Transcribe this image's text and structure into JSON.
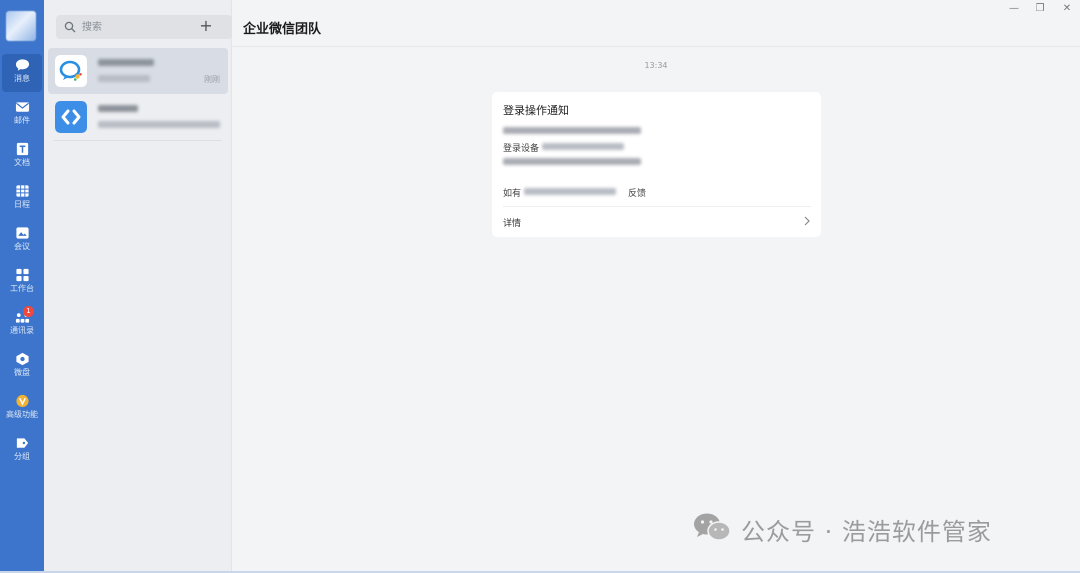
{
  "sidebar": {
    "items": [
      {
        "label": "消息",
        "icon": "chat-bubble-icon",
        "active": true
      },
      {
        "label": "邮件",
        "icon": "mail-icon"
      },
      {
        "label": "文档",
        "icon": "document-icon"
      },
      {
        "label": "日程",
        "icon": "calendar-icon"
      },
      {
        "label": "会议",
        "icon": "meeting-icon"
      },
      {
        "label": "工作台",
        "icon": "workbench-icon"
      },
      {
        "label": "通讯录",
        "icon": "contacts-icon",
        "badge": "1"
      },
      {
        "label": "微盘",
        "icon": "drive-icon"
      },
      {
        "label": "高级功能",
        "icon": "vip-icon"
      },
      {
        "label": "分组",
        "icon": "group-tag-icon"
      }
    ]
  },
  "search": {
    "placeholder": "搜索"
  },
  "conversations": [
    {
      "time": "刚刚",
      "active": true
    },
    {
      "time": ""
    }
  ],
  "chat": {
    "title": "企业微信团队",
    "timestamp": "13:34",
    "card": {
      "title": "登录操作通知",
      "line_device": "登录设备",
      "line_feedback_prefix": "如有",
      "line_feedback_suffix": "反馈",
      "detail_label": "详情"
    }
  },
  "window_controls": {
    "minimize": "—",
    "restore": "❐",
    "close": "✕"
  },
  "watermark": {
    "text": "公众号 · 浩浩软件管家"
  },
  "colors": {
    "rail": "#3c75cb",
    "rail_active": "#2f63b6",
    "badge": "#f0483e",
    "chat_bg": "#f3f4f6"
  }
}
